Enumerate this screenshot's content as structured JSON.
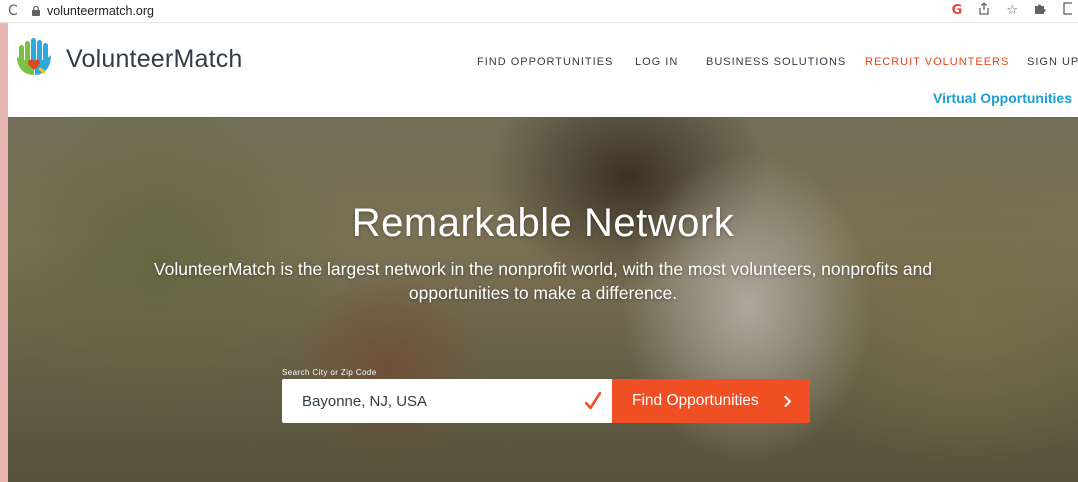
{
  "browser": {
    "url": "volunteermatch.org",
    "icons": [
      "reload-icon",
      "lock-icon",
      "google-icon",
      "share-icon",
      "bookmark-star-icon",
      "extensions-icon",
      "sidepanel-icon"
    ],
    "google_letter": "G",
    "reload_glyph": "C"
  },
  "header": {
    "brand": "VolunteerMatch",
    "nav": [
      {
        "label": "FIND OPPORTUNITIES"
      },
      {
        "label": "LOG IN"
      },
      {
        "label": "BUSINESS SOLUTIONS"
      },
      {
        "label": "RECRUIT VOLUNTEERS",
        "accent": true
      },
      {
        "label": "SIGN UP"
      }
    ],
    "virtual_link": "Virtual Opportunities"
  },
  "hero": {
    "title": "Remarkable Network",
    "subtitle": "VolunteerMatch is the largest network in the nonprofit world, with the most volunteers, nonprofits and opportunities to make a difference.",
    "search_label": "Search City or Zip Code",
    "search_value": "Bayonne, NJ, USA",
    "button_label": "Find Opportunities"
  },
  "colors": {
    "accent_orange": "#f04e23",
    "nav_accent": "#e2461c",
    "link_blue": "#199fd9",
    "text_dark": "#333c44",
    "outer_background": "#e9b7b1"
  }
}
